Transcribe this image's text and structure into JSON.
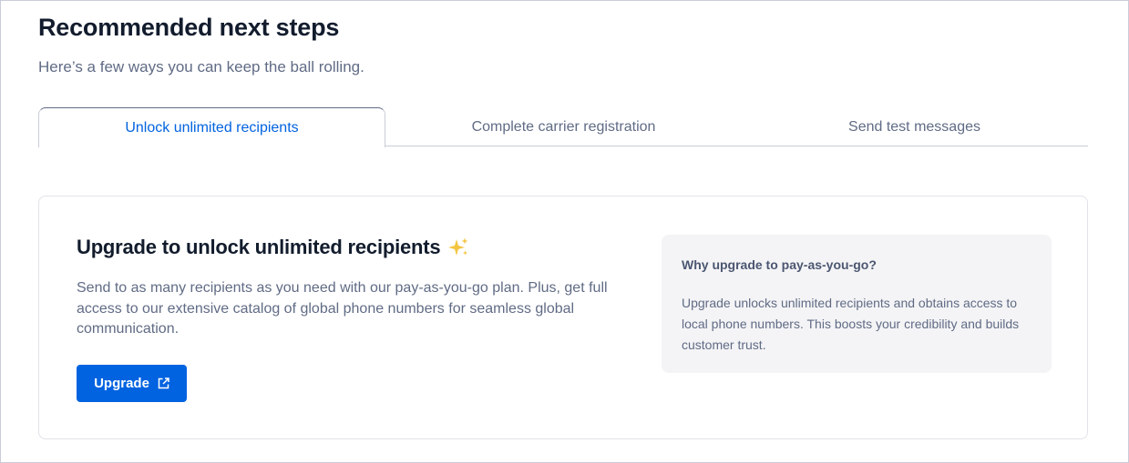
{
  "header": {
    "title": "Recommended next steps",
    "subtitle": "Here’s a few ways you can keep the ball rolling."
  },
  "tabs": [
    {
      "label": "Unlock unlimited recipients",
      "active": true
    },
    {
      "label": "Complete carrier registration",
      "active": false
    },
    {
      "label": "Send test messages",
      "active": false
    }
  ],
  "card": {
    "heading": "Upgrade to unlock unlimited recipients",
    "heading_icon": "sparkles-icon",
    "body": "Send to as many recipients as you need with our pay-as-you-go plan. Plus, get full access to our extensive catalog of global phone numbers for seamless global communication.",
    "button_label": "Upgrade",
    "button_icon": "external-link-icon"
  },
  "aside": {
    "title": "Why upgrade to pay-as-you-go?",
    "body": "Upgrade unlocks unlimited recipients and obtains access to local phone numbers. This boosts your credibility and builds customer trust."
  },
  "colors": {
    "primary": "#0263e0",
    "text_strong": "#121c2d",
    "text_weak": "#606b85",
    "border": "#cacdd8",
    "aside_bg": "#f4f4f6",
    "sparkle": "#f4c542"
  }
}
